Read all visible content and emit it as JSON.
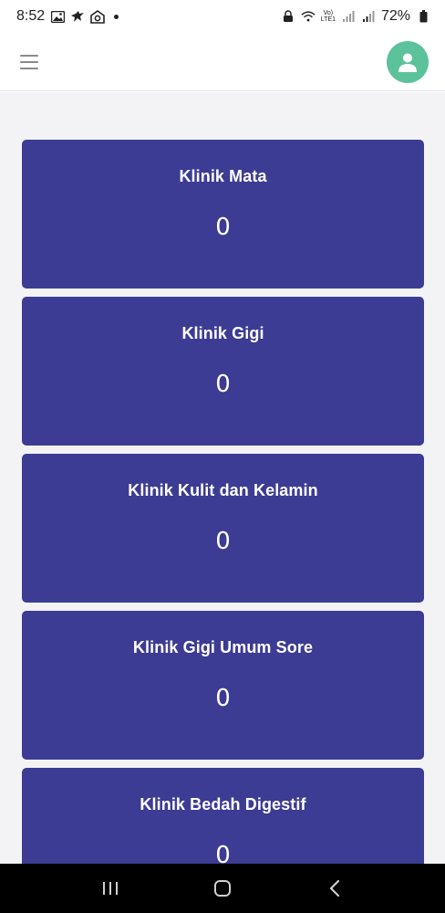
{
  "status_bar": {
    "time": "8:52",
    "battery": "72%",
    "icons": [
      "gallery-icon",
      "bird-icon",
      "home-shield-icon",
      "notification-dot",
      "lock-icon",
      "wifi-icon",
      "volte-icon",
      "signal-icon",
      "signal-icon-2",
      "battery-icon"
    ],
    "network_label_top": "Vo)",
    "network_label_bottom": "LTE1"
  },
  "header": {
    "menu_icon": "hamburger-menu-icon",
    "avatar_icon": "user-avatar-icon",
    "avatar_color": "#5cc29b"
  },
  "colors": {
    "card_bg": "#3c3c94",
    "content_bg": "#f3f3f6"
  },
  "clinics": [
    {
      "name": "Klinik Mata",
      "count": "0"
    },
    {
      "name": "Klinik Gigi",
      "count": "0"
    },
    {
      "name": "Klinik Kulit dan Kelamin",
      "count": "0"
    },
    {
      "name": "Klinik Gigi Umum Sore",
      "count": "0"
    },
    {
      "name": "Klinik Bedah Digestif",
      "count": "0"
    }
  ],
  "nav_bar": {
    "icons": [
      "recent-apps-icon",
      "home-icon",
      "back-icon"
    ]
  }
}
